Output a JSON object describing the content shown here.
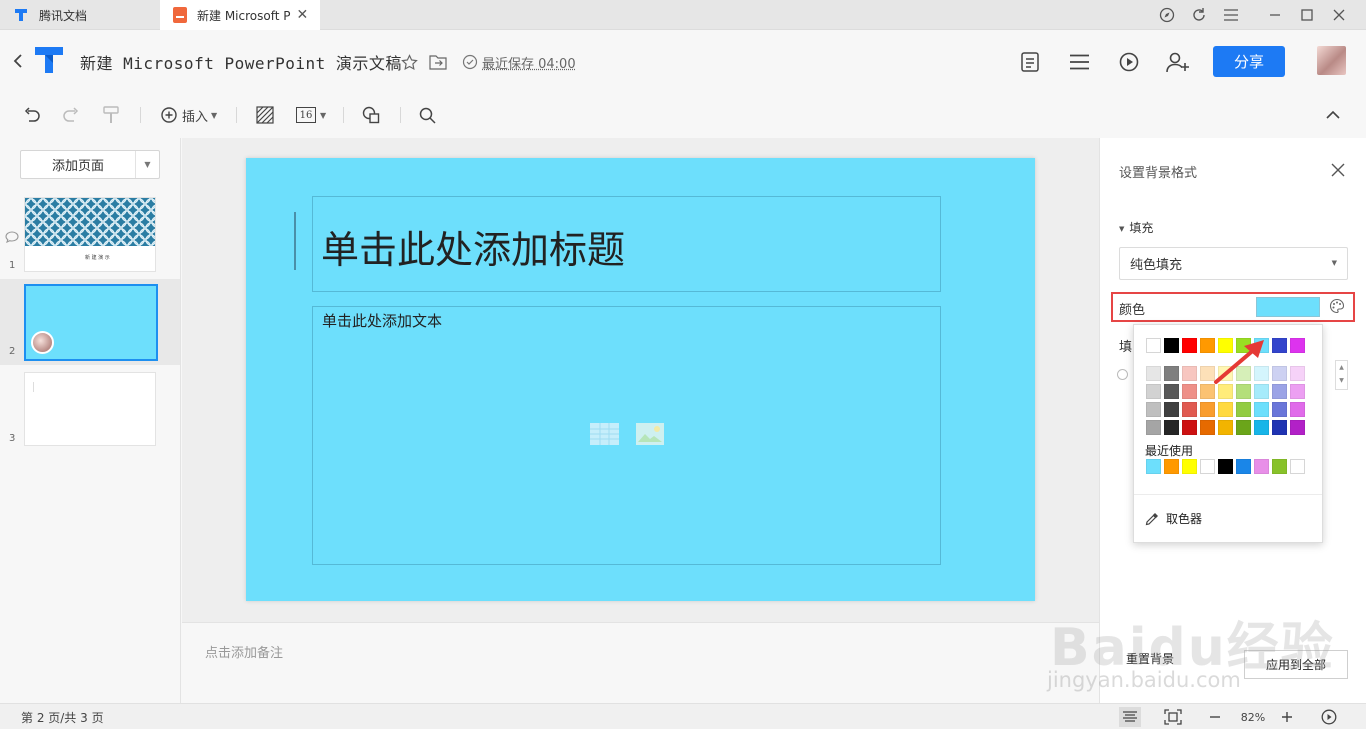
{
  "tabs": [
    {
      "label": "腾讯文档",
      "active": false
    },
    {
      "label": "新建 Microsoft P",
      "active": true
    }
  ],
  "header": {
    "doc_title": "新建 Microsoft PowerPoint 演示文稿",
    "save_status": "最近保存 04:00",
    "share_label": "分享"
  },
  "toolbar": {
    "insert_label": "插入",
    "font_size": "16"
  },
  "slides_panel": {
    "add_page_label": "添加页面",
    "thumbnails": [
      {
        "num": "1",
        "caption": "新 建 演 示"
      },
      {
        "num": "2"
      },
      {
        "num": "3"
      }
    ]
  },
  "slide": {
    "title_placeholder": "单击此处添加标题",
    "body_placeholder": "单击此处添加文本",
    "background_color": "#6ddffc"
  },
  "notes": {
    "placeholder": "点击添加备注"
  },
  "format_panel": {
    "title": "设置背景格式",
    "fill_section": "填充",
    "fill_type": "纯色填充",
    "color_label": "颜色",
    "partial_label": "填",
    "reset_label": "重置背景",
    "apply_all_label": "应用到全部"
  },
  "color_popup": {
    "standard_colors": [
      "#ffffff",
      "#000000",
      "#ff0000",
      "#ff9900",
      "#ffff00",
      "#99dd22",
      "#6ddffc",
      "#3344cc",
      "#dd33ee"
    ],
    "shade_grid": [
      [
        "#e6e6e6",
        "#7f7f7f",
        "#f7c6c0",
        "#fde0b8",
        "#fff6b3",
        "#d6efb8",
        "#d4f5fd",
        "#cdd1f2",
        "#f6d2f8"
      ],
      [
        "#d2d2d2",
        "#595959",
        "#ee9088",
        "#fbc272",
        "#ffec7a",
        "#b4df7a",
        "#a6ebfb",
        "#9ba3e6",
        "#ec9ff2"
      ],
      [
        "#bfbfbf",
        "#404040",
        "#e05a50",
        "#f99d2e",
        "#ffd940",
        "#92cc42",
        "#6ddffc",
        "#6a76d9",
        "#e06bea"
      ],
      [
        "#a5a5a5",
        "#262626",
        "#cc1111",
        "#e66a00",
        "#f2b400",
        "#6ba51a",
        "#18b5e8",
        "#1f33b2",
        "#b221c7"
      ]
    ],
    "recent_label": "最近使用",
    "recent_colors": [
      "#6ddffc",
      "#ff9900",
      "#ffff00",
      "#ffffff",
      "#000000",
      "#1a86e8",
      "#e88fe8",
      "#88c22a",
      "#ffffff"
    ],
    "picker_label": "取色器"
  },
  "statusbar": {
    "page_info": "第 2 页/共 3 页",
    "zoom": "82%"
  },
  "watermark": {
    "logo": "Baidu经验",
    "url": "jingyan.baidu.com"
  }
}
